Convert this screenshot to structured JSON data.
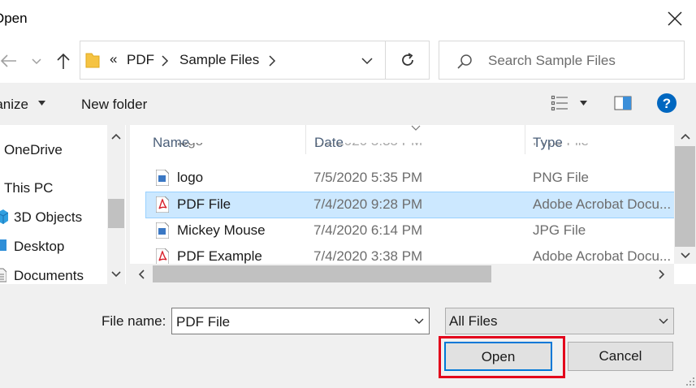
{
  "dialog": {
    "title": "Open"
  },
  "address": {
    "overflow_label": "«",
    "segments": [
      "PDF",
      "Sample Files"
    ]
  },
  "search": {
    "placeholder": "Search Sample Files"
  },
  "toolbar": {
    "organize_label": "Organize",
    "new_folder_label": "New folder"
  },
  "nav_pane": {
    "items": [
      {
        "label": "OneDrive",
        "icon": "cloud-icon"
      },
      {
        "label": "This PC",
        "icon": "computer-icon"
      },
      {
        "label": "3D Objects",
        "icon": "cube-icon"
      },
      {
        "label": "Desktop",
        "icon": "desktop-icon"
      },
      {
        "label": "Documents",
        "icon": "document-icon"
      }
    ]
  },
  "file_list": {
    "columns": [
      "Name",
      "Date",
      "Type"
    ],
    "rows": [
      {
        "name": "logo",
        "date": "7/5/2020 5:35 PM",
        "type": "PNG File",
        "icon": "image-file-icon",
        "partial": true
      },
      {
        "name": "logo",
        "date": "7/5/2020 5:35 PM",
        "type": "PNG File",
        "icon": "image-file-icon"
      },
      {
        "name": "PDF File",
        "date": "7/4/2020 9:28 PM",
        "type": "Adobe Acrobat Docu...",
        "icon": "pdf-file-icon",
        "selected": true
      },
      {
        "name": "Mickey Mouse",
        "date": "7/4/2020 6:14 PM",
        "type": "JPG File",
        "icon": "image-file-icon"
      },
      {
        "name": "PDF Example",
        "date": "7/4/2020 3:38 PM",
        "type": "Adobe Acrobat Docu...",
        "icon": "pdf-file-icon"
      }
    ]
  },
  "footer": {
    "file_name_label": "File name:",
    "file_name_value": "PDF File",
    "filter_value": "All Files",
    "open_label": "Open",
    "cancel_label": "Cancel"
  },
  "colors": {
    "selection": "#cce8ff",
    "accent": "#0078d7",
    "highlight": "#e3001b",
    "pdf_red": "#d9232e",
    "help_blue": "#0067c0"
  }
}
